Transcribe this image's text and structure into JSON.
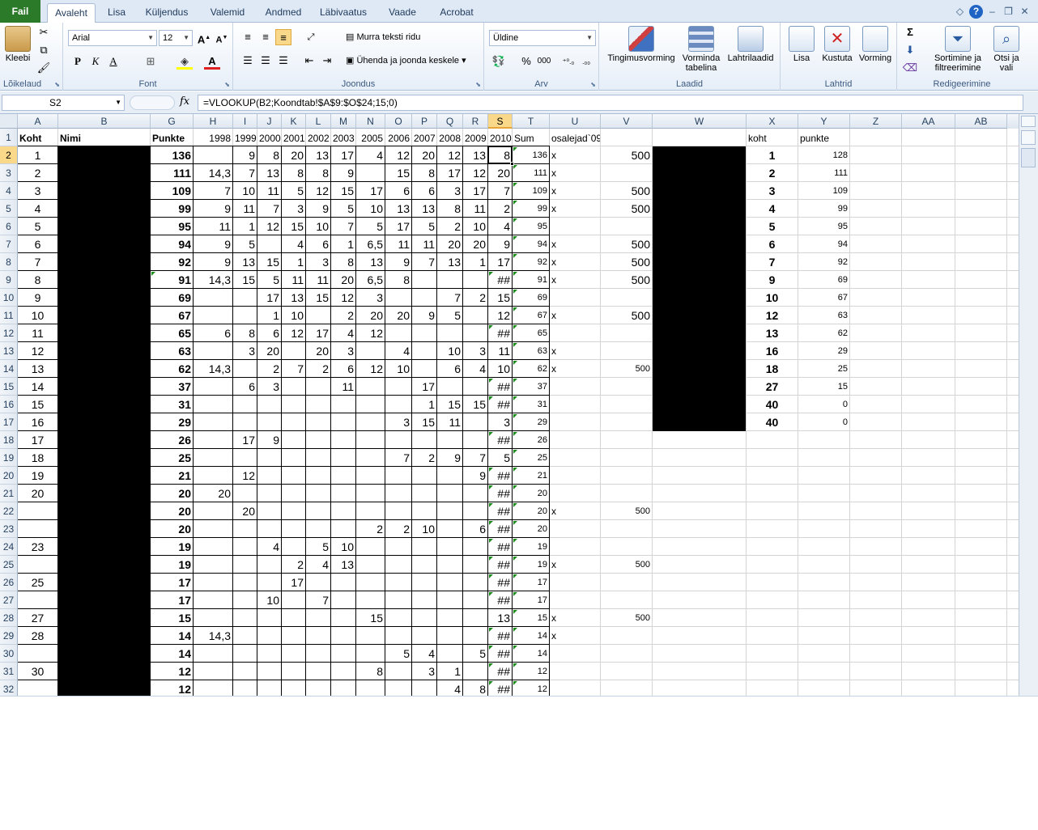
{
  "app": {
    "ribbon_tabs": [
      "Fail",
      "Avaleht",
      "Lisa",
      "Küljendus",
      "Valemid",
      "Andmed",
      "Läbivaatus",
      "Vaade",
      "Acrobat"
    ],
    "active_tab": "Avaleht"
  },
  "ribbon": {
    "clipboard": {
      "label": "Lõikelaud",
      "paste_label": "Kleebi"
    },
    "font": {
      "label": "Font",
      "family": "Arial",
      "size": "12",
      "bold": "P",
      "italic": "K",
      "underline": "A"
    },
    "alignment": {
      "label": "Joondus",
      "wrap_text": "Murra teksti ridu",
      "merge_center": "Ühenda ja joonda keskele"
    },
    "number": {
      "label": "Arv",
      "format": "Üldine",
      "percent": "%",
      "thousands": "000"
    },
    "styles": {
      "label": "Laadid",
      "conditional": "Tingimusvorming",
      "format_table": "Vorminda tabelina",
      "cell_styles": "Lahtrilaadid"
    },
    "cells": {
      "label": "Lahtrid",
      "insert": "Lisa",
      "delete": "Kustuta",
      "format": "Vorming"
    },
    "editing": {
      "label": "Redigeerimine",
      "sum": "Σ",
      "sort_filter": "Sortimine ja filtreerimine",
      "find_select": "Otsi ja vali"
    }
  },
  "formula_bar": {
    "name_box": "S2",
    "fx": "fx",
    "formula": "=VLOOKUP(B2;Koondtab!$A$9:$O$24;15;0)"
  },
  "sheet": {
    "columns": [
      "A",
      "B",
      "G",
      "H",
      "I",
      "J",
      "K",
      "L",
      "M",
      "N",
      "O",
      "P",
      "Q",
      "R",
      "S",
      "T",
      "U",
      "V",
      "W",
      "X",
      "Y",
      "Z",
      "AA",
      "AB"
    ],
    "selected_column": "S",
    "selected_row": "2",
    "header_row": {
      "A": "Koht",
      "B": "Nimi",
      "G": "Punkte",
      "H": "1998",
      "I": "1999",
      "J": "2000",
      "K": "2001",
      "L": "2002",
      "M": "2003",
      "N": "2005",
      "O": "2006",
      "P": "2007",
      "Q": "2008",
      "R": "2009",
      "S": "2010",
      "T": "Sum",
      "U": "osalejad`09",
      "X": "koht",
      "Y": "punkte"
    },
    "rows": [
      {
        "n": "2",
        "A": "1",
        "G": "136",
        "H": "",
        "I": "9",
        "J": "8",
        "K": "20",
        "L": "13",
        "M": "17",
        "N": "4",
        "O": "12",
        "P": "20",
        "Q": "12",
        "R": "13",
        "S": "8",
        "T": "136",
        "U": "x",
        "V": "500",
        "X": "1",
        "Y": "128"
      },
      {
        "n": "3",
        "A": "2",
        "G": "111",
        "H": "14,3",
        "I": "7",
        "J": "13",
        "K": "8",
        "L": "8",
        "M": "9",
        "N": "",
        "O": "15",
        "P": "8",
        "Q": "17",
        "R": "12",
        "S": "20",
        "T": "111",
        "U": "x",
        "V": "",
        "X": "2",
        "Y": "111"
      },
      {
        "n": "4",
        "A": "3",
        "G": "109",
        "H": "7",
        "I": "10",
        "J": "11",
        "K": "5",
        "L": "12",
        "M": "15",
        "N": "17",
        "O": "6",
        "P": "6",
        "Q": "3",
        "R": "17",
        "S": "7",
        "T": "109",
        "U": "x",
        "V": "500",
        "X": "3",
        "Y": "109"
      },
      {
        "n": "5",
        "A": "4",
        "G": "99",
        "H": "9",
        "I": "11",
        "J": "7",
        "K": "3",
        "L": "9",
        "M": "5",
        "N": "10",
        "O": "13",
        "P": "13",
        "Q": "8",
        "R": "11",
        "S": "2",
        "T": "99",
        "U": "x",
        "V": "500",
        "X": "4",
        "Y": "99"
      },
      {
        "n": "6",
        "A": "5",
        "G": "95",
        "H": "11",
        "I": "1",
        "J": "12",
        "K": "15",
        "L": "10",
        "M": "7",
        "N": "5",
        "O": "17",
        "P": "5",
        "Q": "2",
        "R": "10",
        "S": "4",
        "T": "95",
        "U": "",
        "V": "",
        "X": "5",
        "Y": "95"
      },
      {
        "n": "7",
        "A": "6",
        "G": "94",
        "H": "9",
        "I": "5",
        "J": "",
        "K": "4",
        "L": "6",
        "M": "1",
        "N": "6,5",
        "O": "11",
        "P": "11",
        "Q": "20",
        "R": "20",
        "S": "9",
        "T": "94",
        "U": "x",
        "V": "500",
        "X": "6",
        "Y": "94"
      },
      {
        "n": "8",
        "A": "7",
        "G": "92",
        "H": "9",
        "I": "13",
        "J": "15",
        "K": "1",
        "L": "3",
        "M": "8",
        "N": "13",
        "O": "9",
        "P": "7",
        "Q": "13",
        "R": "1",
        "S": "17",
        "T": "92",
        "U": "x",
        "V": "500",
        "X": "7",
        "Y": "92"
      },
      {
        "n": "9",
        "A": "8",
        "G": "91",
        "H": "14,3",
        "I": "15",
        "J": "5",
        "K": "11",
        "L": "11",
        "M": "20",
        "N": "6,5",
        "O": "8",
        "P": "",
        "Q": "",
        "R": "",
        "S": "##",
        "T": "91",
        "U": "x",
        "V": "500",
        "X": "9",
        "Y": "69"
      },
      {
        "n": "10",
        "A": "9",
        "G": "69",
        "H": "",
        "I": "",
        "J": "17",
        "K": "13",
        "L": "15",
        "M": "12",
        "N": "3",
        "O": "",
        "P": "",
        "Q": "7",
        "R": "2",
        "S": "15",
        "T": "69",
        "U": "",
        "V": "",
        "X": "10",
        "Y": "67"
      },
      {
        "n": "11",
        "A": "10",
        "G": "67",
        "H": "",
        "I": "",
        "J": "1",
        "K": "10",
        "L": "",
        "M": "2",
        "N": "20",
        "O": "20",
        "P": "9",
        "Q": "5",
        "R": "",
        "S": "12",
        "T": "67",
        "U": "x",
        "V": "500",
        "X": "12",
        "Y": "63"
      },
      {
        "n": "12",
        "A": "11",
        "G": "65",
        "H": "6",
        "I": "8",
        "J": "6",
        "K": "12",
        "L": "17",
        "M": "4",
        "N": "12",
        "O": "",
        "P": "",
        "Q": "",
        "R": "",
        "S": "##",
        "T": "65",
        "U": "",
        "V": "",
        "X": "13",
        "Y": "62"
      },
      {
        "n": "13",
        "A": "12",
        "G": "63",
        "H": "",
        "I": "3",
        "J": "20",
        "K": "",
        "L": "20",
        "M": "3",
        "N": "",
        "O": "4",
        "P": "",
        "Q": "10",
        "R": "3",
        "S": "11",
        "T": "63",
        "U": "x",
        "V": "",
        "X": "16",
        "Y": "29"
      },
      {
        "n": "14",
        "A": "13",
        "G": "62",
        "H": "14,3",
        "I": "",
        "J": "2",
        "K": "7",
        "L": "2",
        "M": "6",
        "N": "12",
        "O": "10",
        "P": "",
        "Q": "6",
        "R": "4",
        "S": "10",
        "T": "62",
        "U": "x",
        "V": "500",
        "X": "18",
        "Y": "25"
      },
      {
        "n": "15",
        "A": "14",
        "G": "37",
        "H": "",
        "I": "6",
        "J": "3",
        "K": "",
        "L": "",
        "M": "11",
        "N": "",
        "O": "",
        "P": "17",
        "Q": "",
        "R": "",
        "S": "##",
        "T": "37",
        "U": "",
        "V": "",
        "X": "27",
        "Y": "15"
      },
      {
        "n": "16",
        "A": "15",
        "G": "31",
        "H": "",
        "I": "",
        "J": "",
        "K": "",
        "L": "",
        "M": "",
        "N": "",
        "O": "",
        "P": "1",
        "Q": "15",
        "R": "15",
        "S": "##",
        "T": "31",
        "U": "",
        "V": "",
        "X": "40",
        "Y": "0"
      },
      {
        "n": "17",
        "A": "16",
        "G": "29",
        "H": "",
        "I": "",
        "J": "",
        "K": "",
        "L": "",
        "M": "",
        "N": "",
        "O": "3",
        "P": "15",
        "Q": "11",
        "R": "",
        "S": "3",
        "T": "29",
        "U": "",
        "V": "",
        "X": "40",
        "Y": "0"
      },
      {
        "n": "18",
        "A": "17",
        "G": "26",
        "H": "",
        "I": "17",
        "J": "9",
        "K": "",
        "L": "",
        "M": "",
        "N": "",
        "O": "",
        "P": "",
        "Q": "",
        "R": "",
        "S": "##",
        "T": "26",
        "U": "",
        "V": "",
        "X": "",
        "Y": ""
      },
      {
        "n": "19",
        "A": "18",
        "G": "25",
        "H": "",
        "I": "",
        "J": "",
        "K": "",
        "L": "",
        "M": "",
        "N": "",
        "O": "7",
        "P": "2",
        "Q": "9",
        "R": "7",
        "S": "5",
        "T": "25",
        "U": "",
        "V": "",
        "X": "",
        "Y": ""
      },
      {
        "n": "20",
        "A": "19",
        "G": "21",
        "H": "",
        "I": "12",
        "J": "",
        "K": "",
        "L": "",
        "M": "",
        "N": "",
        "O": "",
        "P": "",
        "Q": "",
        "R": "9",
        "S": "##",
        "T": "21",
        "U": "",
        "V": "",
        "X": "",
        "Y": ""
      },
      {
        "n": "21",
        "A": "20",
        "G": "20",
        "H": "20",
        "I": "",
        "J": "",
        "K": "",
        "L": "",
        "M": "",
        "N": "",
        "O": "",
        "P": "",
        "Q": "",
        "R": "",
        "S": "##",
        "T": "20",
        "U": "",
        "V": "",
        "X": "",
        "Y": ""
      },
      {
        "n": "22",
        "A": "",
        "G": "20",
        "H": "",
        "I": "20",
        "J": "",
        "K": "",
        "L": "",
        "M": "",
        "N": "",
        "O": "",
        "P": "",
        "Q": "",
        "R": "",
        "S": "##",
        "T": "20",
        "U": "x",
        "V": "500",
        "X": "",
        "Y": ""
      },
      {
        "n": "23",
        "A": "",
        "G": "20",
        "H": "",
        "I": "",
        "J": "",
        "K": "",
        "L": "",
        "M": "",
        "N": "2",
        "O": "2",
        "P": "10",
        "Q": "",
        "R": "6",
        "S": "##",
        "T": "20",
        "U": "",
        "V": "",
        "X": "",
        "Y": ""
      },
      {
        "n": "24",
        "A": "23",
        "G": "19",
        "H": "",
        "I": "",
        "J": "4",
        "K": "",
        "L": "5",
        "M": "10",
        "N": "",
        "O": "",
        "P": "",
        "Q": "",
        "R": "",
        "S": "##",
        "T": "19",
        "U": "",
        "V": "",
        "X": "",
        "Y": ""
      },
      {
        "n": "25",
        "A": "",
        "G": "19",
        "H": "",
        "I": "",
        "J": "",
        "K": "2",
        "L": "4",
        "M": "13",
        "N": "",
        "O": "",
        "P": "",
        "Q": "",
        "R": "",
        "S": "##",
        "T": "19",
        "U": "x",
        "V": "500",
        "X": "",
        "Y": ""
      },
      {
        "n": "26",
        "A": "25",
        "G": "17",
        "H": "",
        "I": "",
        "J": "",
        "K": "17",
        "L": "",
        "M": "",
        "N": "",
        "O": "",
        "P": "",
        "Q": "",
        "R": "",
        "S": "##",
        "T": "17",
        "U": "",
        "V": "",
        "X": "",
        "Y": ""
      },
      {
        "n": "27",
        "A": "",
        "G": "17",
        "H": "",
        "I": "",
        "J": "10",
        "K": "",
        "L": "7",
        "M": "",
        "N": "",
        "O": "",
        "P": "",
        "Q": "",
        "R": "",
        "S": "##",
        "T": "17",
        "U": "",
        "V": "",
        "X": "",
        "Y": ""
      },
      {
        "n": "28",
        "A": "27",
        "G": "15",
        "H": "",
        "I": "",
        "J": "",
        "K": "",
        "L": "",
        "M": "",
        "N": "15",
        "O": "",
        "P": "",
        "Q": "",
        "R": "",
        "S": "13",
        "T": "15",
        "U": "x",
        "V": "500",
        "X": "",
        "Y": ""
      },
      {
        "n": "29",
        "A": "28",
        "G": "14",
        "H": "14,3",
        "I": "",
        "J": "",
        "K": "",
        "L": "",
        "M": "",
        "N": "",
        "O": "",
        "P": "",
        "Q": "",
        "R": "",
        "S": "##",
        "T": "14",
        "U": "x",
        "V": "",
        "X": "",
        "Y": ""
      },
      {
        "n": "30",
        "A": "",
        "G": "14",
        "H": "",
        "I": "",
        "J": "",
        "K": "",
        "L": "",
        "M": "",
        "N": "",
        "O": "5",
        "P": "4",
        "Q": "",
        "R": "5",
        "S": "##",
        "T": "14",
        "U": "",
        "V": "",
        "X": "",
        "Y": ""
      },
      {
        "n": "31",
        "A": "30",
        "G": "12",
        "H": "",
        "I": "",
        "J": "",
        "K": "",
        "L": "",
        "M": "",
        "N": "8",
        "O": "",
        "P": "3",
        "Q": "1",
        "R": "",
        "S": "##",
        "T": "12",
        "U": "",
        "V": "",
        "X": "",
        "Y": ""
      },
      {
        "n": "32",
        "A": "",
        "G": "12",
        "H": "",
        "I": "",
        "J": "",
        "K": "",
        "L": "",
        "M": "",
        "N": "",
        "O": "",
        "P": "",
        "Q": "4",
        "R": "8",
        "S": "##",
        "T": "12",
        "U": "",
        "V": "",
        "X": "",
        "Y": ""
      }
    ]
  }
}
